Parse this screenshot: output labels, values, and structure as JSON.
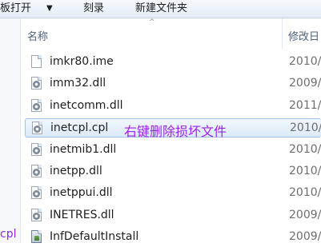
{
  "toolbar": {
    "open_label": "板打开",
    "dropdown_arrow": "▼",
    "burn_label": "刻录",
    "new_folder_label": "新建文件夹"
  },
  "header": {
    "name_label": "名称",
    "date_label": "修改日",
    "sort_indicator": "^"
  },
  "nav": {
    "fragment": "cpl"
  },
  "files": [
    {
      "name": "imkr80.ime",
      "date": "2010/",
      "icon": "blank-file-icon"
    },
    {
      "name": "imm32.dll",
      "date": "2009/",
      "icon": "dll-file-icon"
    },
    {
      "name": "inetcomm.dll",
      "date": "2011/",
      "icon": "dll-file-icon"
    },
    {
      "name": "inetcpl.cpl",
      "date": "2010/",
      "icon": "cpl-file-icon",
      "selected": true,
      "annotation": "右键删除损坏文件"
    },
    {
      "name": "inetmib1.dll",
      "date": "2010/",
      "icon": "dll-file-icon"
    },
    {
      "name": "inetpp.dll",
      "date": "2010/",
      "icon": "dll-file-icon"
    },
    {
      "name": "inetppui.dll",
      "date": "2010/",
      "icon": "dll-file-icon"
    },
    {
      "name": "INETRES.dll",
      "date": "2009/",
      "icon": "dll-file-icon"
    },
    {
      "name": "InfDefaultInstall",
      "date": "2009/",
      "icon": "installer-file-icon"
    }
  ],
  "colors": {
    "annotation": "#a020f0",
    "selection_border": "#9fc2ea"
  }
}
